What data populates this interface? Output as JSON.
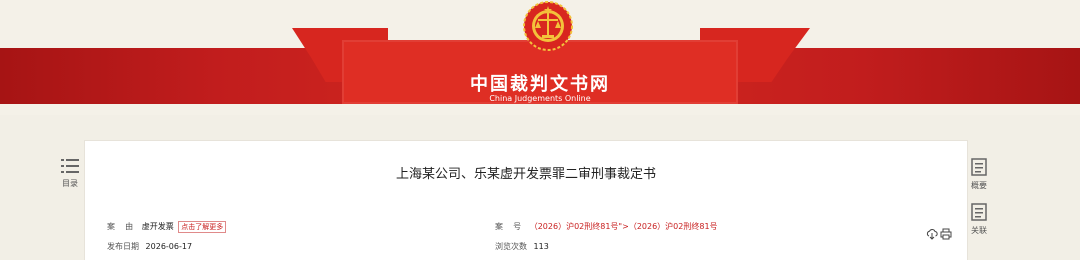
{
  "header": {
    "site_title": "中国裁判文书网",
    "site_subtitle": "China Judgements Online"
  },
  "sidebar_left": {
    "toc_label": "目录"
  },
  "sidebar_right": {
    "summary_label": "概要",
    "related_label": "关联"
  },
  "document": {
    "title": "上海某公司、乐某虚开发票罪二审刑事裁定书",
    "cause_label": "案    由",
    "cause_value": "虚开发票",
    "cause_more": "点击了解更多",
    "case_no_label": "案    号",
    "case_no_value": "（2026）沪02刑终81号\">（2026）沪02刑终81号",
    "publish_date_label": "发布日期",
    "publish_date_value": "2026-06-17",
    "views_label": "浏览次数",
    "views_value": "113"
  },
  "icons": {
    "logo": "court-emblem-icon",
    "toc": "list-icon",
    "summary": "document-icon",
    "related": "document-icon",
    "download": "cloud-download-icon",
    "print": "printer-icon"
  },
  "colors": {
    "band_red": "#d72a21",
    "accent_red": "#c82020",
    "background": "#f2efe6"
  }
}
